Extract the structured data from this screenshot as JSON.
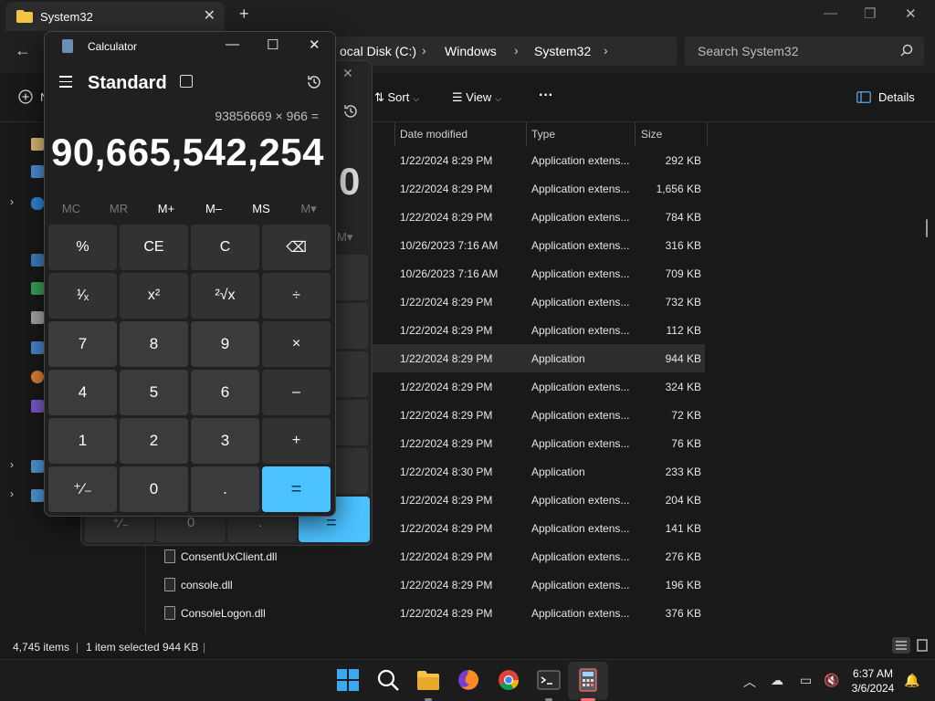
{
  "explorer": {
    "tab_title": "System32",
    "breadcrumb": [
      "ocal Disk (C:)",
      "Windows",
      "System32"
    ],
    "search_placeholder": "Search System32",
    "commands": {
      "new": "N",
      "sort": "Sort",
      "view": "View",
      "more": "···",
      "details": "Details"
    },
    "columns": {
      "date": "Date modified",
      "type": "Type",
      "size": "Size"
    },
    "rows": [
      {
        "name": "",
        "date": "1/22/2024 8:29 PM",
        "type": "Application extens...",
        "size": "292 KB"
      },
      {
        "name": "",
        "date": "1/22/2024 8:29 PM",
        "type": "Application extens...",
        "size": "1,656 KB"
      },
      {
        "name": "",
        "date": "1/22/2024 8:29 PM",
        "type": "Application extens...",
        "size": "784 KB"
      },
      {
        "name": "",
        "date": "10/26/2023 7:16 AM",
        "type": "Application extens...",
        "size": "316 KB"
      },
      {
        "name": "",
        "date": "10/26/2023 7:16 AM",
        "type": "Application extens...",
        "size": "709 KB"
      },
      {
        "name": "",
        "date": "1/22/2024 8:29 PM",
        "type": "Application extens...",
        "size": "732 KB"
      },
      {
        "name": "",
        "date": "1/22/2024 8:29 PM",
        "type": "Application extens...",
        "size": "112 KB"
      },
      {
        "name": "",
        "date": "1/22/2024 8:29 PM",
        "type": "Application",
        "size": "944 KB",
        "selected": true
      },
      {
        "name": "",
        "date": "1/22/2024 8:29 PM",
        "type": "Application extens...",
        "size": "324 KB"
      },
      {
        "name": "",
        "date": "1/22/2024 8:29 PM",
        "type": "Application extens...",
        "size": "72 KB"
      },
      {
        "name": "",
        "date": "1/22/2024 8:29 PM",
        "type": "Application extens...",
        "size": "76 KB"
      },
      {
        "name": "",
        "date": "1/22/2024 8:30 PM",
        "type": "Application",
        "size": "233 KB"
      },
      {
        "name": "",
        "date": "1/22/2024 8:29 PM",
        "type": "Application extens...",
        "size": "204 KB"
      },
      {
        "name": "",
        "date": "1/22/2024 8:29 PM",
        "type": "Application extens...",
        "size": "141 KB"
      },
      {
        "name": "ConsentUxClient.dll",
        "date": "1/22/2024 8:29 PM",
        "type": "Application extens...",
        "size": "276 KB"
      },
      {
        "name": "console.dll",
        "date": "1/22/2024 8:29 PM",
        "type": "Application extens...",
        "size": "196 KB"
      },
      {
        "name": "ConsoleLogon.dll",
        "date": "1/22/2024 8:29 PM",
        "type": "Application extens...",
        "size": "376 KB"
      }
    ],
    "status": {
      "items": "4,745 items",
      "selected": "1 item selected",
      "size": "944 KB"
    }
  },
  "calculator": {
    "title": "Calculator",
    "mode": "Standard",
    "expression": "93856669 × 966 =",
    "result": "90,665,542,254",
    "memory": [
      "MC",
      "MR",
      "M+",
      "M–",
      "MS",
      "M▾"
    ],
    "keys": [
      [
        "%",
        "CE",
        "C",
        "⌫"
      ],
      [
        "¹⁄ₓ",
        "x²",
        "²√x",
        "÷"
      ],
      [
        "7",
        "8",
        "9",
        "×"
      ],
      [
        "4",
        "5",
        "6",
        "–"
      ],
      [
        "1",
        "2",
        "3",
        "+"
      ],
      [
        "⁺⁄₋",
        "0",
        ".",
        "="
      ]
    ]
  },
  "calculator_ghost": {
    "result_fragment": "0",
    "mem_fragment": "M▾",
    "keys_bottom": [
      "⁺⁄₋",
      "0",
      ".",
      "="
    ]
  },
  "taskbar": {
    "time": "6:37 AM",
    "date": "3/6/2024"
  },
  "colors": {
    "accent": "#4cc2ff",
    "folder": "#f4c545"
  }
}
